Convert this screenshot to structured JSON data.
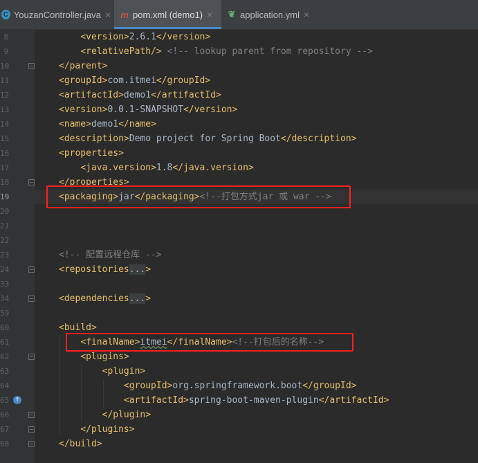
{
  "tabs": [
    {
      "label": "YouzanController.java",
      "icon": "java-class-icon",
      "icon_color": "#3592c4",
      "active": false
    },
    {
      "label": "pom.xml (demo1)",
      "icon": "maven-icon",
      "icon_color": "#c75450",
      "active": true
    },
    {
      "label": "application.yml",
      "icon": "spring-leaf-icon",
      "icon_color": "#6aab73",
      "active": false
    }
  ],
  "close_glyph": "×",
  "line_numbers": [
    "8",
    "9",
    "10",
    "11",
    "12",
    "13",
    "14",
    "15",
    "16",
    "17",
    "18",
    "19",
    "20",
    "21",
    "22",
    "23",
    "24",
    "33",
    "34",
    "59",
    "60",
    "61",
    "62",
    "63",
    "64",
    "65",
    "66",
    "67",
    "68"
  ],
  "code_lines": [
    [
      {
        "t": "    "
      },
      {
        "c": "tg",
        "t": "<version>"
      },
      {
        "c": "ts",
        "t": "2.6.1"
      },
      {
        "c": "tg",
        "t": "</version>"
      }
    ],
    [
      {
        "t": "    "
      },
      {
        "c": "tg",
        "t": "<relativePath/>"
      },
      {
        "t": " "
      },
      {
        "c": "cm",
        "t": "<!-- lookup parent from repository -->"
      }
    ],
    [
      {
        "c": "tg",
        "t": "</parent>"
      }
    ],
    [
      {
        "c": "tg",
        "t": "<groupId>"
      },
      {
        "c": "ts",
        "t": "com.itmei"
      },
      {
        "c": "tg",
        "t": "</groupId>"
      }
    ],
    [
      {
        "c": "tg",
        "t": "<artifactId>"
      },
      {
        "c": "ts",
        "t": "demo1"
      },
      {
        "c": "tg",
        "t": "</artifactId>"
      }
    ],
    [
      {
        "c": "tg",
        "t": "<version>"
      },
      {
        "c": "ts",
        "t": "0.0.1-SNAPSHOT"
      },
      {
        "c": "tg",
        "t": "</version>"
      }
    ],
    [
      {
        "c": "tg",
        "t": "<name>"
      },
      {
        "c": "ts",
        "t": "demo1"
      },
      {
        "c": "tg",
        "t": "</name>"
      }
    ],
    [
      {
        "c": "tg",
        "t": "<description>"
      },
      {
        "c": "ts",
        "t": "Demo project for Spring Boot"
      },
      {
        "c": "tg",
        "t": "</description>"
      }
    ],
    [
      {
        "c": "tg",
        "t": "<properties>"
      }
    ],
    [
      {
        "t": "    "
      },
      {
        "c": "tg",
        "t": "<java.version>"
      },
      {
        "c": "ts",
        "t": "1.8"
      },
      {
        "c": "tg",
        "t": "</java.version>"
      }
    ],
    [
      {
        "c": "tg",
        "t": "</properties>"
      }
    ],
    [
      {
        "c": "tg",
        "t": "<packaging>"
      },
      {
        "c": "ts",
        "t": "jar"
      },
      {
        "c": "tg",
        "t": "</packaging>"
      },
      {
        "c": "cm",
        "t": "<!--打包方式jar 或 war -->"
      }
    ],
    [],
    [],
    [],
    [
      {
        "c": "cm",
        "t": "<!-- 配置远程仓库 -->"
      }
    ],
    [
      {
        "c": "tg",
        "t": "<repositories"
      },
      {
        "c": "fd",
        "t": "..."
      },
      {
        "c": "tg",
        "t": ">"
      }
    ],
    [],
    [
      {
        "c": "tg",
        "t": "<dependencies"
      },
      {
        "c": "fd",
        "t": "..."
      },
      {
        "c": "tg",
        "t": ">"
      }
    ],
    [],
    [
      {
        "c": "tg",
        "t": "<build>"
      }
    ],
    [
      {
        "t": "    "
      },
      {
        "c": "tg",
        "t": "<finalName>"
      },
      {
        "c": "ts",
        "t": "itmei",
        "u": true
      },
      {
        "c": "tg",
        "t": "</finalName>"
      },
      {
        "c": "cm",
        "t": "<!--打包后的名称-->"
      }
    ],
    [
      {
        "t": "    "
      },
      {
        "c": "tg",
        "t": "<plugins>"
      }
    ],
    [
      {
        "t": "        "
      },
      {
        "c": "tg",
        "t": "<plugin>"
      }
    ],
    [
      {
        "t": "            "
      },
      {
        "c": "tg",
        "t": "<groupId>"
      },
      {
        "c": "ts",
        "t": "org.springframework.boot"
      },
      {
        "c": "tg",
        "t": "</groupId>"
      }
    ],
    [
      {
        "t": "            "
      },
      {
        "c": "tg",
        "t": "<artifactId>"
      },
      {
        "c": "ts",
        "t": "spring-boot-maven-plugin"
      },
      {
        "c": "tg",
        "t": "</artifactId>"
      }
    ],
    [
      {
        "t": "        "
      },
      {
        "c": "tg",
        "t": "</plugin>"
      }
    ],
    [
      {
        "t": "    "
      },
      {
        "c": "tg",
        "t": "</plugins>"
      }
    ],
    [
      {
        "c": "tg",
        "t": "</build>"
      }
    ]
  ],
  "current_line_index": 11,
  "gutter_icon_line_index": 25,
  "gutter_icon": "override-icon",
  "highlight_color": "#ff2020"
}
